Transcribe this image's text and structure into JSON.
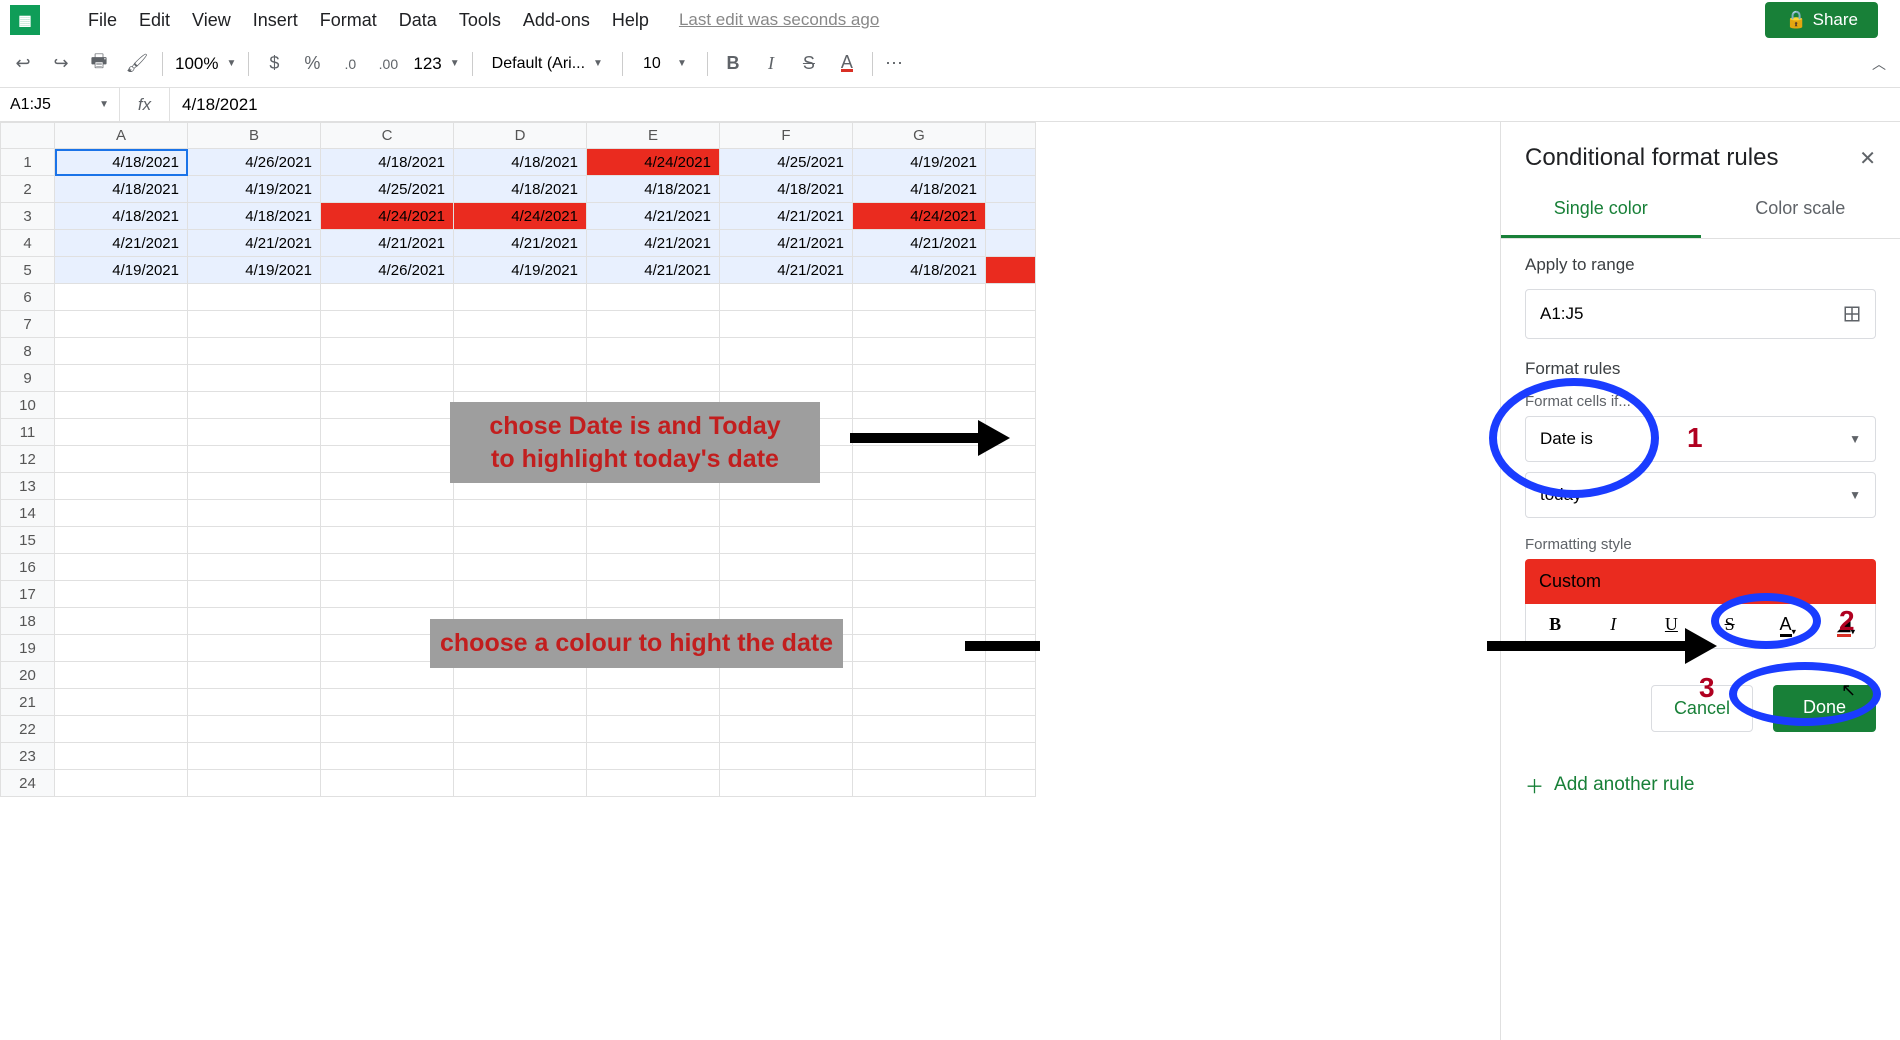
{
  "menubar": {
    "items": [
      "File",
      "Edit",
      "View",
      "Insert",
      "Format",
      "Data",
      "Tools",
      "Add-ons",
      "Help"
    ],
    "last_edit": "Last edit was seconds ago",
    "share": "Share"
  },
  "toolbar": {
    "zoom": "100%",
    "currency": "$",
    "percent": "%",
    "dec_dec": ".0",
    "inc_dec": ".00",
    "num_format": "123",
    "font": "Default (Ari...",
    "font_size": "10",
    "more": "⋯"
  },
  "namebox": "A1:J5",
  "formula": "4/18/2021",
  "columns": [
    "A",
    "B",
    "C",
    "D",
    "E",
    "F",
    "G"
  ],
  "row_count": 24,
  "grid": [
    [
      "4/18/2021",
      "4/26/2021",
      "4/18/2021",
      "4/18/2021",
      "4/24/2021",
      "4/25/2021",
      "4/19/2021"
    ],
    [
      "4/18/2021",
      "4/19/2021",
      "4/25/2021",
      "4/18/2021",
      "4/18/2021",
      "4/18/2021",
      "4/18/2021"
    ],
    [
      "4/18/2021",
      "4/18/2021",
      "4/24/2021",
      "4/24/2021",
      "4/21/2021",
      "4/21/2021",
      "4/24/2021"
    ],
    [
      "4/21/2021",
      "4/21/2021",
      "4/21/2021",
      "4/21/2021",
      "4/21/2021",
      "4/21/2021",
      "4/21/2021"
    ],
    [
      "4/19/2021",
      "4/19/2021",
      "4/26/2021",
      "4/19/2021",
      "4/21/2021",
      "4/21/2021",
      "4/18/2021"
    ]
  ],
  "red_cells": [
    [
      0,
      4
    ],
    [
      2,
      2
    ],
    [
      2,
      3
    ],
    [
      2,
      6
    ]
  ],
  "annotations": {
    "a1_line1": "chose Date is and Today",
    "a1_line2": "to highlight today's date",
    "a2": "choose a colour to hight the date",
    "n1": "1",
    "n2": "2",
    "n3": "3"
  },
  "panel": {
    "title": "Conditional format rules",
    "tab_single": "Single color",
    "tab_scale": "Color scale",
    "apply_label": "Apply to range",
    "range": "A1:J5",
    "rules_label": "Format rules",
    "cells_if": "Format cells if...",
    "condition": "Date is",
    "sub_condition": "today",
    "style_label": "Formatting style",
    "style_name": "Custom",
    "cancel": "Cancel",
    "done": "Done",
    "add_rule": "Add another rule"
  }
}
